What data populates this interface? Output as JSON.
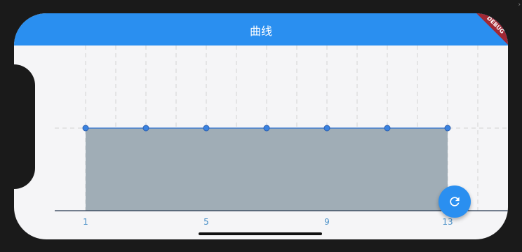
{
  "app": {
    "title": "曲线",
    "debug_banner": "DEBUG"
  },
  "fab": {
    "icon": "refresh-icon"
  },
  "colors": {
    "app_bar": "#2a8ff0",
    "fill": "#a0adb6",
    "line": "#2a6fd0",
    "point": "#3a82e0",
    "grid": "#d3d3d3",
    "baseline": "#263850"
  },
  "chart_data": {
    "type": "area",
    "x": [
      1,
      3,
      5,
      7,
      9,
      11,
      13
    ],
    "values": [
      1,
      1,
      1,
      1,
      1,
      1,
      1
    ],
    "tick_labels": [
      "1",
      "5",
      "9",
      "13"
    ],
    "tick_values": [
      1,
      5,
      9,
      13
    ],
    "xlim": [
      0,
      15
    ],
    "ylim": [
      0,
      2
    ],
    "grid": true,
    "title": "",
    "xlabel": "",
    "ylabel": ""
  }
}
